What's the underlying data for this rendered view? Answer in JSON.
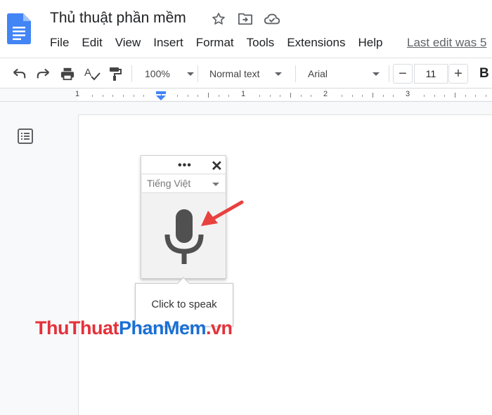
{
  "header": {
    "title": "Thủ thuật phần mềm",
    "icons": [
      "star-icon",
      "move-to-folder-icon",
      "cloud-saved-icon"
    ],
    "menu": [
      "File",
      "Edit",
      "View",
      "Insert",
      "Format",
      "Tools",
      "Extensions",
      "Help"
    ],
    "last_edit": "Last edit was 5"
  },
  "toolbar": {
    "zoom": "100%",
    "style": "Normal text",
    "font": "Arial",
    "font_size": "11",
    "minus": "−",
    "plus": "+",
    "bold": "B"
  },
  "ruler": {
    "labels": [
      "1",
      "1",
      "2",
      "3"
    ]
  },
  "voice_typing": {
    "menu_dots": "•••",
    "close": "✕",
    "language": "Tiếng Việt",
    "tooltip": "Click to speak"
  },
  "watermark": {
    "part1": "ThuThuat",
    "part2": "PhanMem",
    "part3": ".vn"
  },
  "colors": {
    "docs_blue": "#4285f4",
    "arrow_red": "#e8413f",
    "watermark_red": "#e5313a",
    "watermark_blue": "#1a6fd4"
  }
}
